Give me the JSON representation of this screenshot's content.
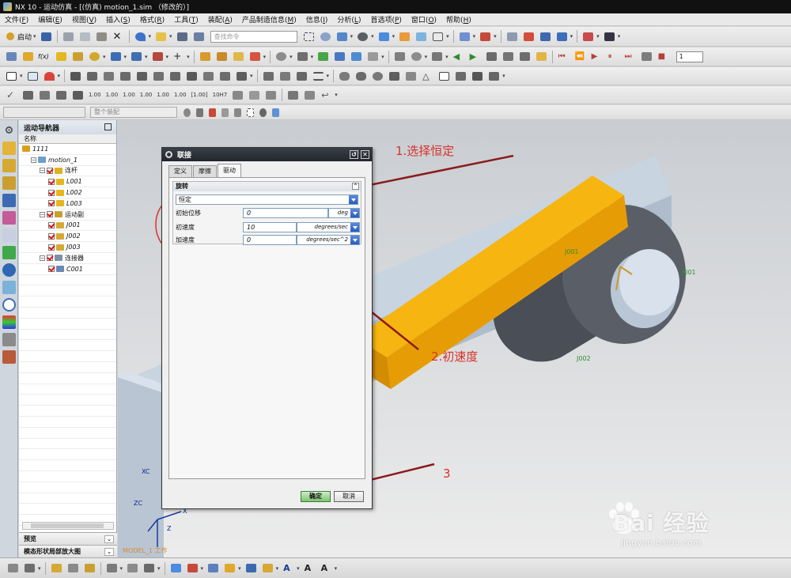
{
  "window": {
    "title": "NX 10 - 运动仿真 - [(仿真) motion_1.sim （修改的）]"
  },
  "menu": [
    {
      "label": "文件(",
      "hk": "F",
      "end": ")"
    },
    {
      "label": "编辑(",
      "hk": "E",
      "end": ")"
    },
    {
      "label": "视图(",
      "hk": "V",
      "end": ")"
    },
    {
      "label": "插入(",
      "hk": "S",
      "end": ")"
    },
    {
      "label": "格式(",
      "hk": "R",
      "end": ")"
    },
    {
      "label": "工具(",
      "hk": "T",
      "end": ")"
    },
    {
      "label": "装配(",
      "hk": "A",
      "end": ")"
    },
    {
      "label": "产品制造信息(",
      "hk": "M",
      "end": ")"
    },
    {
      "label": "信息(",
      "hk": "I",
      "end": ")"
    },
    {
      "label": "分析(",
      "hk": "L",
      "end": ")"
    },
    {
      "label": "首选项(",
      "hk": "P",
      "end": ")"
    },
    {
      "label": "窗口(",
      "hk": "O",
      "end": ")"
    },
    {
      "label": "帮助(",
      "hk": "H",
      "end": ")"
    }
  ],
  "toolbar": {
    "start_label": "启动",
    "search_placeholder": "查找命令",
    "fx_label": "f(x)",
    "spin_value": "1",
    "dim_values": [
      "1.00",
      "1.00",
      "1.00",
      "1.00",
      "1.00",
      "1.00",
      "[1.00]",
      "10H7"
    ],
    "assembly_filter": "整个装配"
  },
  "navigator": {
    "title": "运动导航器",
    "column": "名称",
    "rows": [
      {
        "indent": 0,
        "label": "1111",
        "icon": "root-icon",
        "color": "#d9a020",
        "expand": false,
        "check": false,
        "upright": false
      },
      {
        "indent": 1,
        "label": "motion_1",
        "icon": "motion-icon",
        "color": "#6e9ec9",
        "expand": true,
        "check": false,
        "upright": false
      },
      {
        "indent": 2,
        "label": "连杆",
        "icon": "link-folder-icon",
        "color": "#e0b020",
        "expand": true,
        "check": true,
        "upright": true
      },
      {
        "indent": 3,
        "label": "L001",
        "icon": "link-icon",
        "color": "#e2b81e",
        "expand": false,
        "check": true,
        "upright": false
      },
      {
        "indent": 3,
        "label": "L002",
        "icon": "link-icon",
        "color": "#e2b81e",
        "expand": false,
        "check": true,
        "upright": false
      },
      {
        "indent": 3,
        "label": "L003",
        "icon": "link-icon",
        "color": "#e2b81e",
        "expand": false,
        "check": true,
        "upright": false
      },
      {
        "indent": 2,
        "label": "运动副",
        "icon": "joint-folder-icon",
        "color": "#c9a030",
        "expand": true,
        "check": true,
        "upright": true
      },
      {
        "indent": 3,
        "label": "J001",
        "icon": "joint-icon",
        "color": "#d6a934",
        "expand": false,
        "check": true,
        "upright": false
      },
      {
        "indent": 3,
        "label": "J002",
        "icon": "joint-icon",
        "color": "#d6a934",
        "expand": false,
        "check": true,
        "upright": false
      },
      {
        "indent": 3,
        "label": "J003",
        "icon": "joint-icon",
        "color": "#d6a934",
        "expand": false,
        "check": true,
        "upright": false
      },
      {
        "indent": 2,
        "label": "连接器",
        "icon": "connector-folder-icon",
        "color": "#7f8fa8",
        "expand": true,
        "check": true,
        "upright": true
      },
      {
        "indent": 3,
        "label": "C001",
        "icon": "connector-icon",
        "color": "#6c86b5",
        "expand": false,
        "check": true,
        "upright": false
      }
    ],
    "preview_label": "预览",
    "magnify_label": "模态形状局部放大图"
  },
  "dialog": {
    "title": "联接",
    "tabs": [
      "定义",
      "摩擦",
      "驱动"
    ],
    "active_tab": "驱动",
    "group_title": "旋转",
    "drive_type": "恒定",
    "fields": [
      {
        "label": "初始位移",
        "value": "0",
        "unit": "deg"
      },
      {
        "label": "初速度",
        "value": "10",
        "unit": "degrees/sec"
      },
      {
        "label": "加速度",
        "value": "0",
        "unit": "degrees/sec^2"
      }
    ],
    "ok_label": "确定",
    "cancel_label": "取消"
  },
  "annotations": {
    "step1": "1.选择恒定",
    "step2": "2.初速度",
    "step3": "3",
    "color": "#d9322a"
  },
  "viewport": {
    "model_label": "MODEL_1 工作",
    "labels": [
      "J001",
      "J001",
      "J002"
    ],
    "axes": [
      "XC",
      "ZC",
      "Z",
      "X"
    ]
  },
  "watermark": {
    "brand": "Bai  经验",
    "url": "jingyan.baidu.com"
  }
}
